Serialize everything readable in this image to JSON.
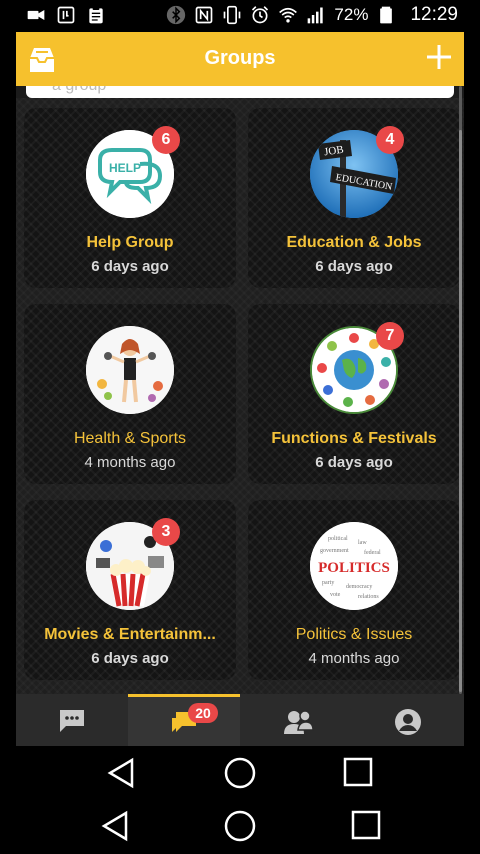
{
  "status_bar": {
    "battery": "72%",
    "time": "12:29",
    "left_icons": [
      "video-camera-icon",
      "sim-toolkit-icon",
      "clipboard-icon"
    ],
    "right_icons": [
      "bluetooth-icon",
      "nfc-icon",
      "vibrate-icon",
      "alarm-icon",
      "wifi-icon",
      "signal-icon",
      "battery-icon"
    ]
  },
  "header": {
    "title": "Groups",
    "left_icon": "inbox-icon",
    "right_icon": "plus-icon"
  },
  "groups": [
    {
      "name": "Help Group",
      "time": "6 days ago",
      "badge": "6",
      "icon": "help-speech-bubble-avatar",
      "unread": true
    },
    {
      "name": "Education & Jobs",
      "time": "6 days ago",
      "badge": "4",
      "icon": "job-education-signpost-avatar",
      "unread": true
    },
    {
      "name": "Health & Sports",
      "time": "4 months ago",
      "badge": "",
      "icon": "fitness-woman-avatar",
      "unread": false
    },
    {
      "name": "Functions & Festivals",
      "time": "6 days ago",
      "badge": "7",
      "icon": "globe-hands-avatar",
      "unread": true
    },
    {
      "name": "Movies & Entertainm...",
      "time": "6 days ago",
      "badge": "3",
      "icon": "popcorn-movie-avatar",
      "unread": true
    },
    {
      "name": "Politics & Issues",
      "time": "4 months ago",
      "badge": "",
      "icon": "politics-wordcloud-avatar",
      "unread": false
    }
  ],
  "tabs": [
    {
      "name": "chats",
      "icon": "chat-bubble-icon",
      "badge": "",
      "active": false
    },
    {
      "name": "groups",
      "icon": "group-chat-icon",
      "badge": "20",
      "active": true
    },
    {
      "name": "contacts",
      "icon": "people-icon",
      "badge": "",
      "active": false
    },
    {
      "name": "profile",
      "icon": "account-circle-icon",
      "badge": "",
      "active": false
    }
  ],
  "avatar_text": {
    "help": "HELP",
    "job": "JOB",
    "education": "EDUCATION",
    "politics": "POLITICS"
  },
  "colors": {
    "accent": "#f6c12d",
    "badge": "#e94848",
    "group_name": "#f4c23a",
    "background": "#1b1b1b"
  }
}
